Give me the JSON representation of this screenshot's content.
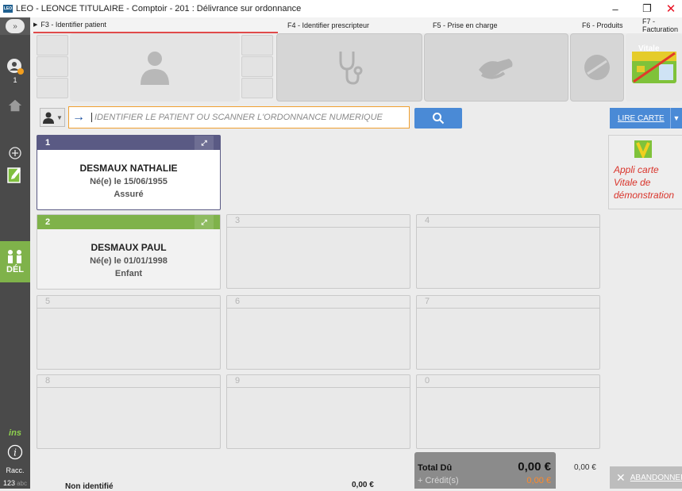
{
  "window": {
    "title": "LEO - LEONCE TITULAIRE - Comptoir - 201 : Délivrance sur ordonnance",
    "logo_text": "LEO",
    "minimize": "–",
    "restore": "❐",
    "close": "✕"
  },
  "tabs": [
    {
      "label": "F3 - Identifier patient"
    },
    {
      "label": "F4 - Identifier prescripteur"
    },
    {
      "label": "F5 - Prise en charge"
    },
    {
      "label": "F6 - Produits"
    },
    {
      "label": "F7 - Facturation"
    }
  ],
  "sidebar": {
    "badge_count": "1",
    "del_label": "DÉL",
    "ins_label": "ins",
    "racc_label": "Racc.",
    "kbd_label": "123",
    "kbd_label2": "abc"
  },
  "vitale": {
    "label": "Vitale"
  },
  "search": {
    "placeholder": "IDENTIFIER LE PATIENT OU SCANNER L'ORDONNANCE NUMERIQUE"
  },
  "lire_carte": {
    "label": "LIRE CARTE"
  },
  "patients": [
    {
      "slot": "1",
      "name": "DESMAUX NATHALIE",
      "dob": "Né(e) le 15/06/1955",
      "role": "Assuré",
      "color": "#5a5a84"
    },
    {
      "slot": "2",
      "name": "DESMAUX PAUL",
      "dob": "Né(e) le 01/01/1998",
      "role": "Enfant",
      "color": "#7fb24a"
    }
  ],
  "empty_slots": [
    "3",
    "4",
    "5",
    "6",
    "7",
    "8",
    "9",
    "0"
  ],
  "appli_carte": {
    "line1": "Appli carte",
    "line2": "Vitale de",
    "line3": "démonstration"
  },
  "footer": {
    "total_label": "Total Dû",
    "total_value": "0,00 €",
    "credit_label": "+ Crédit(s)",
    "credit_value": "0,00 €",
    "side_value": "0,00 €",
    "abandon_label": "ABANDONNER",
    "non_identifie": "Non identifié",
    "non_identifie_value": "0,00 €"
  }
}
